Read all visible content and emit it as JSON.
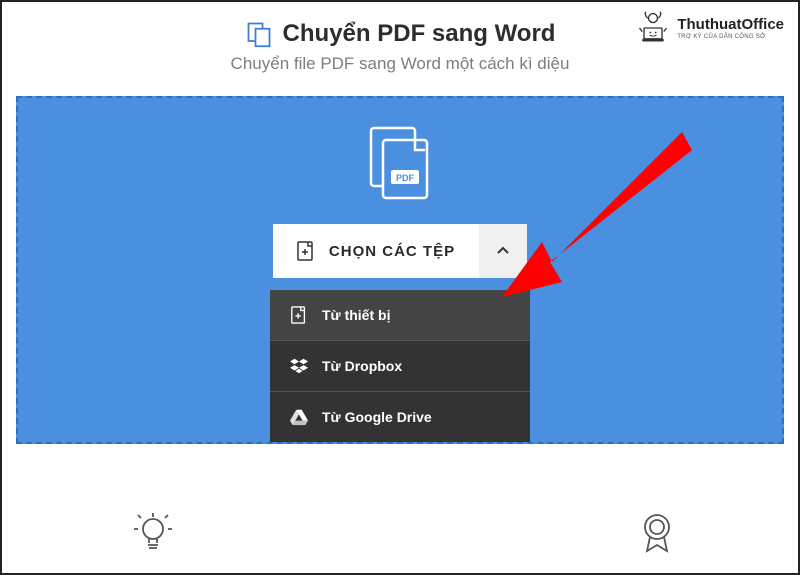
{
  "header": {
    "title": "Chuyển PDF sang Word",
    "subtitle": "Chuyển file PDF sang Word một cách kì diệu"
  },
  "watermark": {
    "name": "ThuthuatOffice",
    "tagline": "TRỢ KÝ CỦA DÂN CÔNG SỞ"
  },
  "dropzone": {
    "choose_label": "CHỌN CÁC TỆP"
  },
  "dropdown": {
    "items": [
      {
        "label": "Từ thiết bị",
        "icon": "file-add-icon"
      },
      {
        "label": "Từ Dropbox",
        "icon": "dropbox-icon"
      },
      {
        "label": "Từ Google Drive",
        "icon": "google-drive-icon"
      }
    ]
  },
  "colors": {
    "dropzone_bg": "#4a8fe0",
    "dropdown_bg": "#333333",
    "accent_arrow": "#ff0000"
  }
}
